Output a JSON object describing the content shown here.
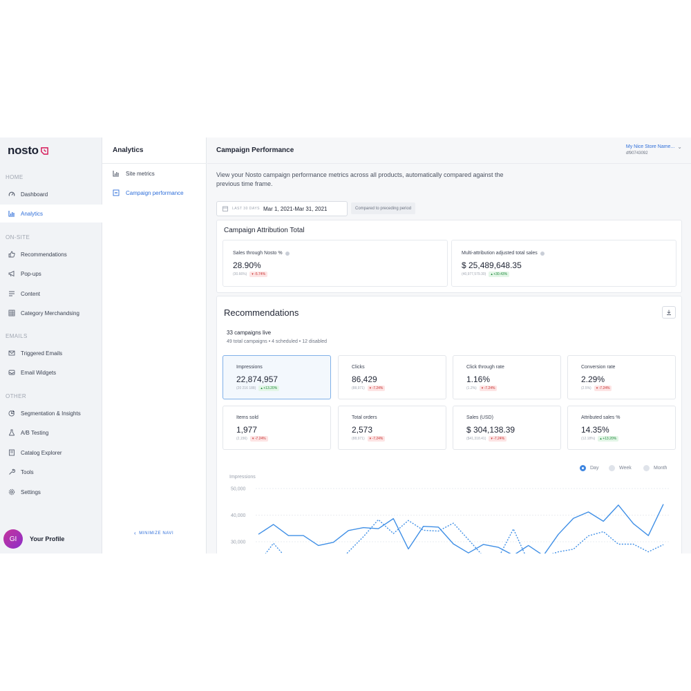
{
  "brand": {
    "logo_text": "nosto"
  },
  "sidebar": {
    "section_home": "HOME",
    "section_onsite": "ON-SITE",
    "section_emails": "EMAILS",
    "section_other": "OTHER",
    "items": [
      {
        "label": "Dashboard",
        "icon": "speedometer-icon"
      },
      {
        "label": "Analytics",
        "icon": "bar-chart-icon",
        "active": true
      },
      {
        "label": "Recommendations",
        "icon": "thumbs-up-icon"
      },
      {
        "label": "Pop-ups",
        "icon": "megaphone-icon"
      },
      {
        "label": "Content",
        "icon": "lines-icon"
      },
      {
        "label": "Category Merchandsing",
        "icon": "grid-icon"
      },
      {
        "label": "Triggered Emails",
        "icon": "envelope-icon"
      },
      {
        "label": "Email Widgets",
        "icon": "inbox-icon"
      },
      {
        "label": "Segmentation & Insights",
        "icon": "pie-chart-icon"
      },
      {
        "label": "A/B Testing",
        "icon": "flask-icon"
      },
      {
        "label": "Catalog Explorer",
        "icon": "catalog-icon"
      },
      {
        "label": "Tools",
        "icon": "wrench-icon"
      },
      {
        "label": "Settings",
        "icon": "gear-icon"
      }
    ],
    "profile": {
      "initials": "GI",
      "name": "Your Profile"
    }
  },
  "subnav": {
    "title": "Analytics",
    "items": [
      {
        "label": "Site metrics",
        "icon": "bar-chart-icon"
      },
      {
        "label": "Campaign performance",
        "icon": "campaign-icon",
        "active": true
      }
    ],
    "minimize": "MINIMIZE NAVI"
  },
  "header": {
    "title": "Campaign Performance",
    "store_name": "My Nice Store Name...",
    "store_id": "df90743092"
  },
  "intro": "View your Nosto campaign performance metrics across all products, automatically compared against the previous time frame.",
  "date_filter": {
    "label": "LAST 30 DAYS",
    "value": "Mar 1, 2021-Mar 31, 2021",
    "compare": "Compared to preceding period"
  },
  "attribution": {
    "title": "Campaign Attribution Total",
    "kpis": [
      {
        "label": "Sales through Nosto %",
        "value": "28.90%",
        "prev": "(30.66%)",
        "delta": "-5.74%",
        "trend": "neg"
      },
      {
        "label": "Multi-attribution adjusted total sales",
        "value": "$ 25,489,648.35",
        "prev": "(40,977,579.30)",
        "delta": "+30.43%",
        "trend": "pos"
      }
    ]
  },
  "recommendations": {
    "title": "Recommendations",
    "live": "33 campaigns live",
    "summary": "49 total campaigns • 4 scheduled • 12 disabled",
    "metrics": [
      {
        "label": "Impressions",
        "value": "22,874,957",
        "prev": "(20 216 188)",
        "delta": "+13.20%",
        "trend": "pos",
        "selected": true
      },
      {
        "label": "Clicks",
        "value": "86,429",
        "prev": "(88,971)",
        "delta": "-7.24%",
        "trend": "neg"
      },
      {
        "label": "Click through rate",
        "value": "1.16%",
        "prev": "(1.2%)",
        "delta": "-7.24%",
        "trend": "neg"
      },
      {
        "label": "Conversion rate",
        "value": "2.29%",
        "prev": "(2.5%)",
        "delta": "-7.24%",
        "trend": "neg"
      },
      {
        "label": "Items sold",
        "value": "1,977",
        "prev": "(2,156)",
        "delta": "-7.24%",
        "trend": "neg"
      },
      {
        "label": "Total orders",
        "value": "2,573",
        "prev": "(88,971)",
        "delta": "-7.24%",
        "trend": "neg"
      },
      {
        "label": "Sales (USD)",
        "value": "$ 304,138.39",
        "prev": "($41,318.41)",
        "delta": "-7.24%",
        "trend": "neg"
      },
      {
        "label": "Attributed sales %",
        "value": "14.35%",
        "prev": "(12.18%)",
        "delta": "+13.20%",
        "trend": "pos"
      }
    ],
    "granularity": [
      "Day",
      "Week",
      "Month"
    ],
    "granularity_selected": "Day"
  },
  "colors": {
    "accent": "#2e6ed9",
    "line": "#3f8fe6",
    "neg": "#c83636",
    "pos": "#208a3c"
  },
  "chart_data": {
    "type": "line",
    "ylabel": "Impressions",
    "y_ticks": [
      "50,000",
      "40,000",
      "30,000"
    ],
    "ylim": [
      25000,
      52000
    ],
    "series": [
      {
        "style": "solid",
        "values": [
          32800,
          36500,
          32300,
          32300,
          28600,
          29800,
          34200,
          35300,
          34900,
          38700,
          27300,
          35800,
          35500,
          29200,
          25800,
          29000,
          27900,
          24900,
          28600,
          24800,
          32800,
          38800,
          41200,
          37700,
          43800,
          36800,
          32300,
          44100
        ]
      },
      {
        "style": "dotted",
        "values": [
          22000,
          29400,
          23000,
          21500,
          23700,
          20300,
          26200,
          31900,
          38300,
          33100,
          38000,
          34300,
          34000,
          37000,
          30800,
          24500,
          24000,
          34800,
          22400,
          24400,
          26200,
          27200,
          32200,
          33800,
          29100,
          29100,
          26200,
          28900
        ]
      }
    ]
  }
}
